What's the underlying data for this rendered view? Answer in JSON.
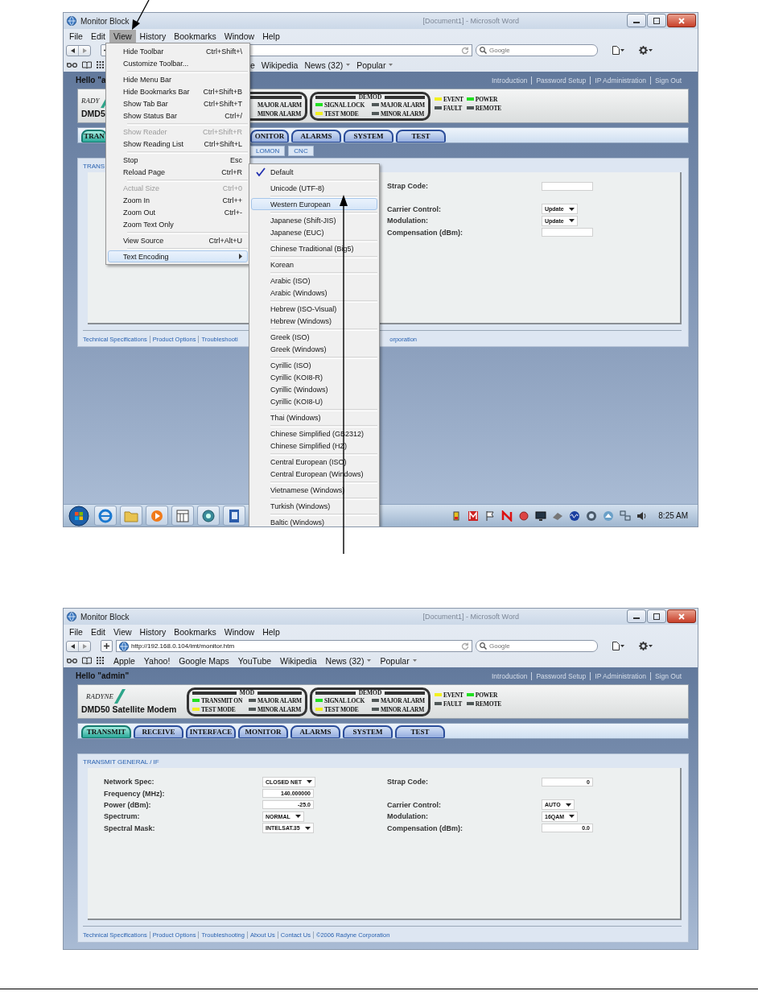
{
  "screenshots": [
    {
      "kind": "menu_open",
      "window": {
        "title": "Monitor Block",
        "background_title": "[Document1] - Microsoft Word"
      },
      "menu_bar": [
        {
          "label": "File",
          "selected": false
        },
        {
          "label": "Edit",
          "selected": false
        },
        {
          "label": "View",
          "selected": true
        },
        {
          "label": "History",
          "selected": false
        },
        {
          "label": "Bookmarks",
          "selected": false
        },
        {
          "label": "Window",
          "selected": false
        },
        {
          "label": "Help",
          "selected": false
        }
      ],
      "toolbar": {
        "search_placeholder": "Google"
      },
      "bookmarks": [
        {
          "label": "e",
          "kind": "link"
        },
        {
          "label": "Wikipedia",
          "kind": "link"
        },
        {
          "label": "News (32)",
          "kind": "folder"
        },
        {
          "label": "Popular",
          "kind": "folder"
        }
      ],
      "page": {
        "greeting": "Hello \"a",
        "top_links": [
          "Introduction",
          "Password Setup",
          "IP Administration",
          "Sign Out"
        ],
        "logo": {
          "brand": "RADY",
          "model": "DMD5"
        },
        "led_groups": [
          {
            "kind": "framed",
            "leds": [
              {
                "label": "MAJOR ALARM"
              },
              {
                "label": "MINOR ALARM"
              }
            ]
          },
          {
            "kind": "framed",
            "title": "DEMOD",
            "leds": [
              {
                "label": "SIGNAL LOCK",
                "color": "#22e022"
              },
              {
                "label": "TEST MODE",
                "color": "#f2f020"
              },
              {
                "label": "MAJOR ALARM",
                "color": "#505858"
              },
              {
                "label": "MINOR ALARM",
                "color": "#505858"
              }
            ]
          },
          {
            "kind": "plain",
            "leds": [
              {
                "label": "EVENT",
                "color": "#f2f020"
              },
              {
                "label": "FAULT",
                "color": "#505858"
              },
              {
                "label": "POWER",
                "color": "#22e022"
              },
              {
                "label": "REMOTE",
                "color": "#505858"
              }
            ]
          }
        ],
        "tabs": [
          {
            "label": "TRAN",
            "selected": true
          },
          {
            "label": "ONITOR",
            "selected": false
          },
          {
            "label": "ALARMS",
            "selected": false
          },
          {
            "label": "SYSTEM",
            "selected": false
          },
          {
            "label": "TEST",
            "selected": false
          }
        ],
        "subtabs": [
          {
            "label": "LOMON"
          },
          {
            "label": "CNC"
          }
        ],
        "content": {
          "title": "TRANS",
          "right_fields": [
            {
              "label": "Strap Code:",
              "kind": "input"
            },
            {
              "label": "Carrier Control:",
              "kind": "select",
              "value": "Update"
            },
            {
              "label": "Modulation:",
              "kind": "select",
              "value": "Update"
            },
            {
              "label": "Compensation (dBm):",
              "kind": "input"
            }
          ]
        },
        "footer_links": [
          "Technical Specifications",
          "Product Options",
          "Troubleshooti",
          "orporation"
        ]
      },
      "open_menu": {
        "groups": [
          [
            {
              "label": "Hide Toolbar",
              "shortcut": "Ctrl+Shift+\\",
              "disabled": false,
              "selected": false
            },
            {
              "label": "Customize Toolbar...",
              "disabled": false,
              "selected": false
            }
          ],
          [
            {
              "label": "Hide Menu Bar",
              "disabled": false,
              "selected": false
            },
            {
              "label": "Hide Bookmarks Bar",
              "shortcut": "Ctrl+Shift+B",
              "disabled": false,
              "selected": false
            },
            {
              "label": "Show Tab Bar",
              "shortcut": "Ctrl+Shift+T",
              "disabled": false,
              "selected": false
            },
            {
              "label": "Show Status Bar",
              "shortcut": "Ctrl+/",
              "disabled": false,
              "selected": false
            }
          ],
          [
            {
              "label": "Show Reader",
              "shortcut": "Ctrl+Shift+R",
              "disabled": true,
              "selected": false
            },
            {
              "label": "Show Reading List",
              "shortcut": "Ctrl+Shift+L",
              "disabled": false,
              "selected": false
            }
          ],
          [
            {
              "label": "Stop",
              "shortcut": "Esc",
              "disabled": false,
              "selected": false
            },
            {
              "label": "Reload Page",
              "shortcut": "Ctrl+R",
              "disabled": false,
              "selected": false
            }
          ],
          [
            {
              "label": "Actual Size",
              "shortcut": "Ctrl+0",
              "disabled": true,
              "selected": false
            },
            {
              "label": "Zoom In",
              "shortcut": "Ctrl++",
              "disabled": false,
              "selected": false
            },
            {
              "label": "Zoom Out",
              "shortcut": "Ctrl+-",
              "disabled": false,
              "selected": false
            },
            {
              "label": "Zoom Text Only",
              "disabled": false,
              "selected": false
            }
          ],
          [
            {
              "label": "View Source",
              "shortcut": "Ctrl+Alt+U",
              "disabled": false,
              "selected": false
            }
          ],
          [
            {
              "label": "Text Encoding",
              "disabled": false,
              "selected": true,
              "submenu": {
                "groups": [
                  [
                    {
                      "label": "Default",
                      "checked": true,
                      "selected": false
                    }
                  ],
                  [
                    {
                      "label": "Unicode (UTF-8)",
                      "checked": false,
                      "selected": false
                    }
                  ],
                  [
                    {
                      "label": "Western European",
                      "checked": false,
                      "selected": true
                    }
                  ],
                  [
                    {
                      "label": "Japanese (Shift-JIS)",
                      "checked": false,
                      "selected": false
                    },
                    {
                      "label": "Japanese (EUC)",
                      "checked": false,
                      "selected": false
                    }
                  ],
                  [
                    {
                      "label": "Chinese Traditional (Big5)",
                      "checked": false,
                      "selected": false
                    }
                  ],
                  [
                    {
                      "label": "Korean",
                      "checked": false,
                      "selected": false
                    }
                  ],
                  [
                    {
                      "label": "Arabic (ISO)",
                      "checked": false,
                      "selected": false
                    },
                    {
                      "label": "Arabic (Windows)",
                      "checked": false,
                      "selected": false
                    }
                  ],
                  [
                    {
                      "label": "Hebrew (ISO-Visual)",
                      "checked": false,
                      "selected": false
                    },
                    {
                      "label": "Hebrew (Windows)",
                      "checked": false,
                      "selected": false
                    }
                  ],
                  [
                    {
                      "label": "Greek (ISO)",
                      "checked": false,
                      "selected": false
                    },
                    {
                      "label": "Greek (Windows)",
                      "checked": false,
                      "selected": false
                    }
                  ],
                  [
                    {
                      "label": "Cyrillic (ISO)",
                      "checked": false,
                      "selected": false
                    },
                    {
                      "label": "Cyrillic (KOI8-R)",
                      "checked": false,
                      "selected": false
                    },
                    {
                      "label": "Cyrillic (Windows)",
                      "checked": false,
                      "selected": false
                    },
                    {
                      "label": "Cyrillic (KOI8-U)",
                      "checked": false,
                      "selected": false
                    }
                  ],
                  [
                    {
                      "label": "Thai (Windows)",
                      "checked": false,
                      "selected": false
                    }
                  ],
                  [
                    {
                      "label": "Chinese Simplified (GB2312)",
                      "checked": false,
                      "selected": false
                    },
                    {
                      "label": "Chinese Simplified (HZ)",
                      "checked": false,
                      "selected": false
                    }
                  ],
                  [
                    {
                      "label": "Central European (ISO)",
                      "checked": false,
                      "selected": false
                    },
                    {
                      "label": "Central European (Windows)",
                      "checked": false,
                      "selected": false
                    }
                  ],
                  [
                    {
                      "label": "Vietnamese (Windows)",
                      "checked": false,
                      "selected": false
                    }
                  ],
                  [
                    {
                      "label": "Turkish (Windows)",
                      "checked": false,
                      "selected": false
                    }
                  ],
                  [
                    {
                      "label": "Baltic (Windows)",
                      "checked": false,
                      "selected": false
                    }
                  ]
                ]
              }
            }
          ]
        ]
      },
      "taskbar": {
        "clock": "8:25 AM"
      }
    },
    {
      "kind": "plain",
      "window": {
        "title": "Monitor Block",
        "background_title": "[Document1] - Microsoft Word"
      },
      "menu_bar": [
        {
          "label": "File",
          "selected": false
        },
        {
          "label": "Edit",
          "selected": false
        },
        {
          "label": "View",
          "selected": false
        },
        {
          "label": "History",
          "selected": false
        },
        {
          "label": "Bookmarks",
          "selected": false
        },
        {
          "label": "Window",
          "selected": false
        },
        {
          "label": "Help",
          "selected": false
        }
      ],
      "toolbar": {
        "address": "http://192.168.0.104/imt/monitor.htm",
        "search_placeholder": "Google"
      },
      "bookmarks": [
        {
          "label": "Apple",
          "kind": "link"
        },
        {
          "label": "Yahoo!",
          "kind": "link"
        },
        {
          "label": "Google Maps",
          "kind": "link"
        },
        {
          "label": "YouTube",
          "kind": "link"
        },
        {
          "label": "Wikipedia",
          "kind": "link"
        },
        {
          "label": "News (32)",
          "kind": "folder"
        },
        {
          "label": "Popular",
          "kind": "folder"
        }
      ],
      "page": {
        "greeting": "Hello \"admin\"",
        "top_links": [
          "Introduction",
          "Password Setup",
          "IP Administration",
          "Sign Out"
        ],
        "logo": {
          "brand": "RADYNE",
          "model": "DMD50 Satellite Modem"
        },
        "led_groups": [
          {
            "kind": "framed",
            "title": "MOD",
            "leds": [
              {
                "label": "TRANSMIT ON",
                "color": "#22e022"
              },
              {
                "label": "TEST MODE",
                "color": "#f2f020"
              },
              {
                "label": "MAJOR ALARM",
                "color": "#505858"
              },
              {
                "label": "MINOR ALARM",
                "color": "#505858"
              }
            ]
          },
          {
            "kind": "framed",
            "title": "DEMOD",
            "leds": [
              {
                "label": "SIGNAL LOCK",
                "color": "#22e022"
              },
              {
                "label": "TEST MODE",
                "color": "#f2f020"
              },
              {
                "label": "MAJOR ALARM",
                "color": "#505858"
              },
              {
                "label": "MINOR ALARM",
                "color": "#505858"
              }
            ]
          },
          {
            "kind": "plain",
            "leds": [
              {
                "label": "EVENT",
                "color": "#f2f020"
              },
              {
                "label": "FAULT",
                "color": "#505858"
              },
              {
                "label": "POWER",
                "color": "#22e022"
              },
              {
                "label": "REMOTE",
                "color": "#505858"
              }
            ]
          }
        ],
        "tabs": [
          {
            "label": "TRANSMIT",
            "selected": true
          },
          {
            "label": "RECEIVE",
            "selected": false
          },
          {
            "label": "INTERFACE",
            "selected": false
          },
          {
            "label": "MONITOR",
            "selected": false
          },
          {
            "label": "ALARMS",
            "selected": false
          },
          {
            "label": "SYSTEM",
            "selected": false
          },
          {
            "label": "TEST",
            "selected": false
          }
        ],
        "content": {
          "title": "TRANSMIT GENERAL / IF",
          "left_fields": [
            {
              "label": "Network Spec:",
              "kind": "select",
              "value": "CLOSED NET"
            },
            {
              "label": "Frequency (MHz):",
              "kind": "input",
              "value": "140.000000"
            },
            {
              "label": "Power (dBm):",
              "kind": "input",
              "value": "-25.0"
            },
            {
              "label": "Spectrum:",
              "kind": "select",
              "value": "NORMAL"
            },
            {
              "label": "Spectral Mask:",
              "kind": "select",
              "value": "INTELSAT.35"
            }
          ],
          "right_fields": [
            {
              "label": "Strap Code:",
              "kind": "input",
              "value": "0"
            },
            {
              "label": "Carrier Control:",
              "kind": "select",
              "value": "AUTO"
            },
            {
              "label": "Modulation:",
              "kind": "select",
              "value": "16QAM"
            },
            {
              "label": "Compensation (dBm):",
              "kind": "input",
              "value": "0.0"
            }
          ]
        },
        "footer_links": [
          "Technical Specifications",
          "Product Options",
          "Troubleshooting",
          "About Us",
          "Contact Us",
          "©2006 Radyne Corporation"
        ]
      }
    }
  ]
}
